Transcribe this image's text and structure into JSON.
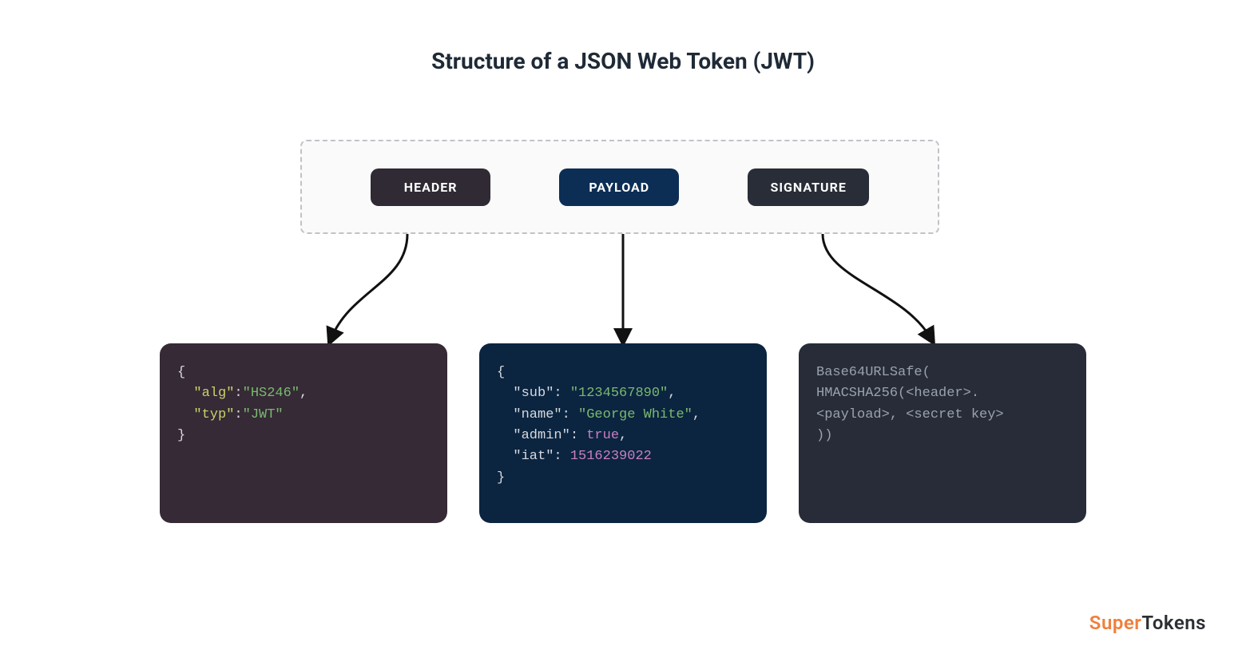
{
  "title": "Structure of a JSON Web Token (JWT)",
  "parts": {
    "header": {
      "label": "HEADER"
    },
    "payload": {
      "label": "PAYLOAD"
    },
    "signature": {
      "label": "SIGNATURE"
    }
  },
  "header_content": {
    "alg_key": "\"alg\"",
    "alg_val": "\"HS246\"",
    "typ_key": "\"typ\"",
    "typ_val": "\"JWT\""
  },
  "payload_content": {
    "sub_key": "\"sub\"",
    "sub_val": "\"1234567890\"",
    "name_key": "\"name\"",
    "name_val": "\"George White\"",
    "admin_key": "\"admin\"",
    "admin_val": "true",
    "iat_key": "\"iat\"",
    "iat_val": "1516239022"
  },
  "signature_content": {
    "line1": "Base64URLSafe(",
    "line2": "HMACSHA256(<header>.",
    "line3": "<payload>, <secret key>",
    "line4": "))"
  },
  "braces": {
    "open": "{",
    "close": "}"
  },
  "punct": {
    "colon": ":",
    "comma": ","
  },
  "brand": {
    "part1": "Super",
    "part2": "Tokens"
  }
}
